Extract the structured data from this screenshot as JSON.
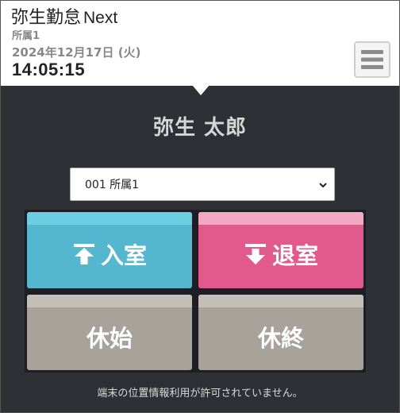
{
  "header": {
    "app_name_jp": "弥生勤怠",
    "app_name_en": "Next",
    "affiliation": "所属1",
    "date": "2024年12月17日 (火)",
    "time": "14:05:15",
    "menu_icon": "hamburger-menu-icon"
  },
  "main": {
    "user_name": "弥生 太郎",
    "affiliation_select": {
      "selected": "001 所属1"
    },
    "buttons": {
      "clock_in": "入室",
      "clock_out": "退室",
      "break_start": "休始",
      "break_end": "休終"
    },
    "notice": "端末の位置情報利用が許可されていません。"
  },
  "colors": {
    "background": "#2e3036",
    "clock_in": "#54b7cf",
    "clock_out": "#e25a8b",
    "break": "#a7a39b"
  }
}
